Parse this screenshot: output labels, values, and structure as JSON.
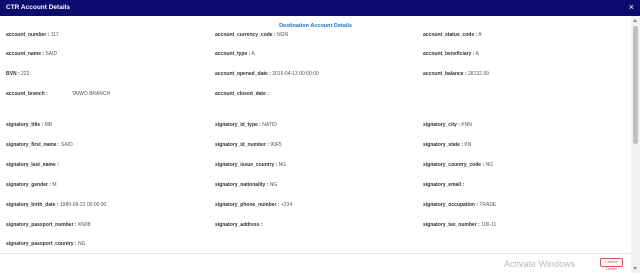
{
  "window": {
    "title": "CTR Account Details",
    "close_glyph": "×"
  },
  "section_title": "Destination Account Details",
  "fields": {
    "account_number": {
      "label": "account_number :",
      "value": " 117"
    },
    "account_currency_code": {
      "label": "account_currency_code :",
      "value": " NGN"
    },
    "account_status_code": {
      "label": "account_status_code :",
      "value": " A"
    },
    "account_name": {
      "label": "account_name :",
      "value": " SAID"
    },
    "account_type": {
      "label": "account_type :",
      "value": " A"
    },
    "account_beneficiary": {
      "label": "account_beneficiary :",
      "value": " A"
    },
    "bvn": {
      "label": "BVN :",
      "value": " 222"
    },
    "account_opened_date": {
      "label": "account_opened_date :",
      "value": " 2015-04-13 00:00:00"
    },
    "account_balance": {
      "label": "account_balance :",
      "value": " 28132.99"
    },
    "account_branch": {
      "label": "account_branch :",
      "value": "TAIWO BRANCH"
    },
    "account_closed_date": {
      "label": "account_closed_date :",
      "value": ""
    },
    "signatory_title": {
      "label": "signatory_title :",
      "value": " MR"
    },
    "signatory_id_type": {
      "label": "signatory_id_type :",
      "value": " NATID"
    },
    "signatory_city": {
      "label": "signatory_city :",
      "value": " KNN"
    },
    "signatory_first_name": {
      "label": "signatory_first_name :",
      "value": " SAID"
    },
    "signatory_id_number": {
      "label": "signatory_id_number :",
      "value": " 90F5"
    },
    "signatory_state": {
      "label": "signatory_state :",
      "value": " KN"
    },
    "signatory_last_name": {
      "label": "signatory_last_name :",
      "value": ""
    },
    "signatory_issue_country": {
      "label": "signatory_issue_country :",
      "value": " NG"
    },
    "signatory_country_code": {
      "label": "signatory_country_code :",
      "value": " NG"
    },
    "signatory_gender": {
      "label": "signatory_gender :",
      "value": " M"
    },
    "signatory_nationality": {
      "label": "signatory_nationality :",
      "value": " NG"
    },
    "signatory_email": {
      "label": "signatory_email :",
      "value": ""
    },
    "signatory_birth_date": {
      "label": "signatory_birth_date :",
      "value": " 1980-09-22 00:00:00"
    },
    "signatory_phone_number": {
      "label": "signatory_phone_number :",
      "value": " +234"
    },
    "signatory_occupation": {
      "label": "signatory_occupation :",
      "value": " TRADE"
    },
    "signatory_passport_number": {
      "label": "signatory_passport_number :",
      "value": " KN08"
    },
    "signatory_address": {
      "label": "signatory_address :",
      "value": ""
    },
    "signatory_tax_number": {
      "label": "signatory_tax_number :",
      "value": " 100-11"
    },
    "signatory_passport_country": {
      "label": "signatory_passport_country :",
      "value": " NG"
    }
  },
  "footer": {
    "watermark": "Activate Windows",
    "dismiss_label": "Dismiss Details"
  },
  "colors": {
    "titlebar": "#0c0b6e",
    "section_title": "#1a73c9",
    "dismiss": "#d9534f"
  }
}
